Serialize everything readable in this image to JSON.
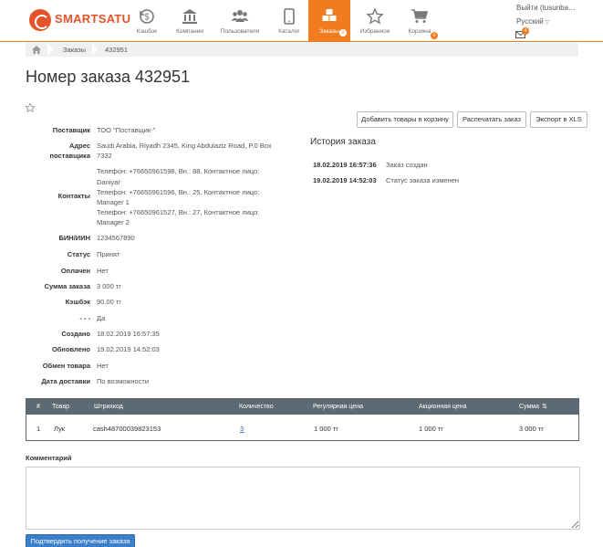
{
  "brand": {
    "name": "SMARTSATU"
  },
  "nav": {
    "items": [
      {
        "label": "Кэшбэк"
      },
      {
        "label": "Компании"
      },
      {
        "label": "Пользователи"
      },
      {
        "label": "Каталог"
      },
      {
        "label": "Заказы",
        "badge": "0"
      },
      {
        "label": "Избранное"
      },
      {
        "label": "Корзина",
        "badge": "0"
      }
    ],
    "active": "Заказы",
    "accent_color": "#f07c22"
  },
  "user": {
    "logout": "Выйти (tusunba…",
    "language": "Русский",
    "mail_badge": "4"
  },
  "breadcrumb": {
    "items": [
      "Заказы",
      "432951"
    ]
  },
  "page_title": "Номер заказа 432951",
  "actions": {
    "add_to_cart": "Добавить товары в корзину",
    "print": "Распечатать заказ",
    "export": "Экспорт в XLS"
  },
  "details": {
    "supplier_label": "Поставщик",
    "supplier": "ТОО \"Поставщик-\"",
    "address_label_1": "Адрес",
    "address_label_2": "поставщика",
    "address_1": "Saudi Arabia, Riyadh 2345, King Abdulaziz Road, P.0 Box",
    "address_2": "7332",
    "contacts_label": "Контакты",
    "contacts": [
      "Телефон: +76650961598, Вн.: 88, Контактное лицо:",
      "Daniyar",
      "Телефон: +76650961596, Вн.: 25, Контактное лицо:",
      "Manager 1",
      "Телефон: +76650961527, Вн.: 27, Контактное лицо:",
      "Manager 2"
    ],
    "bin_label": "БИН/ИИН",
    "bin": "1234567890",
    "status_label": "Статус",
    "status": "Принят",
    "paid_label": "Оплачен",
    "paid": "Нет",
    "sum_label": "Сумма заказа",
    "sum": "3 000 тг",
    "cashback_label": "Кэшбэк",
    "cashback": "90.00 тг",
    "dash_label": "- - -",
    "dash_value": "Да",
    "created_label": "Создано",
    "created": "18.02.2019 16:57:35",
    "updated_label": "Обновлено",
    "updated": "19.02.2019 14:52:03",
    "exchange_label": "Обмен товара",
    "exchange": "Нет",
    "delivery_label": "Дата доставки",
    "delivery": "По возможности"
  },
  "history": {
    "title": "История заказа",
    "entries": [
      {
        "date": "18.02.2019 16:57:36",
        "text": "Заказ создан"
      },
      {
        "date": "19.02.2019 14:52:03",
        "text": "Статус заказа изменен"
      }
    ]
  },
  "table": {
    "headers": [
      "#",
      "Товар",
      "Штрихкод",
      "Количество",
      "Регулярная цена",
      "Акционная цена",
      "Сумма"
    ],
    "rows": [
      {
        "num": "1",
        "product": "Лук",
        "barcode": "cash48700039823153",
        "qty": "3",
        "regular": "1 000 тг",
        "promo": "1 000 тг",
        "sum": "3 000 тг"
      }
    ]
  },
  "comment": {
    "label": "Комментарий",
    "value": ""
  },
  "confirm_button": "Подтвердить получение заказа"
}
